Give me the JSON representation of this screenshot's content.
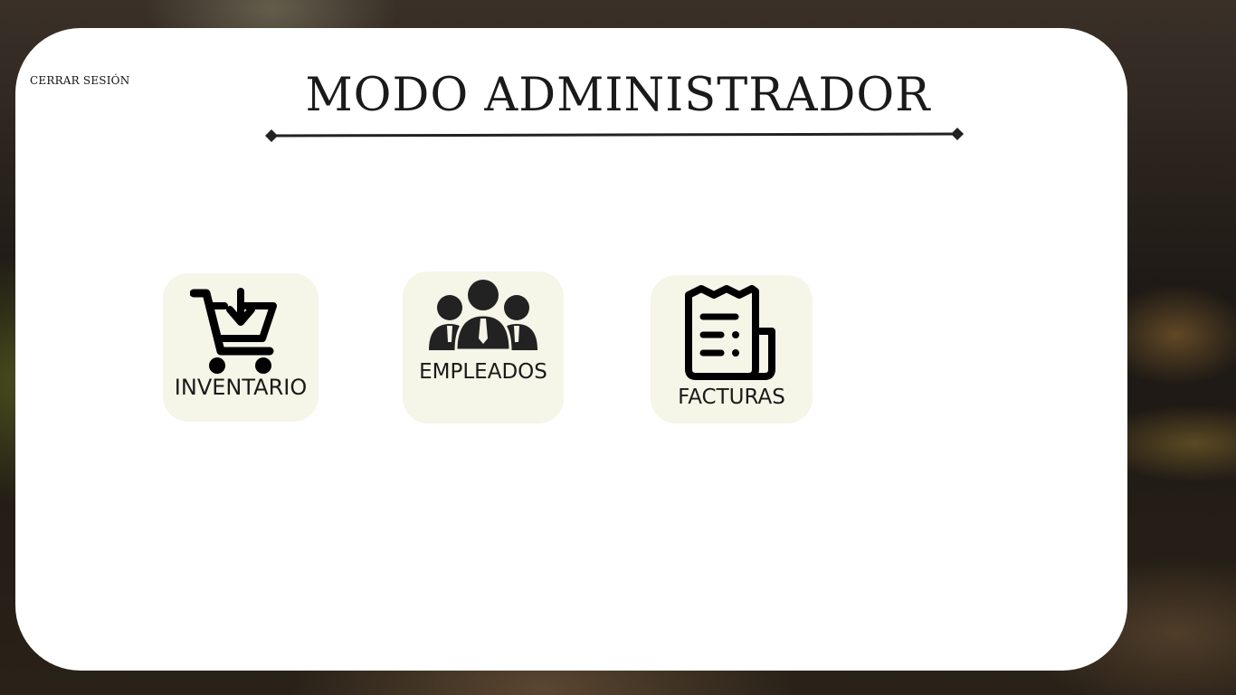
{
  "header": {
    "logout_label": "CERRAR SESIÓN",
    "title": "MODO ADMINISTRADOR"
  },
  "menu": {
    "items": [
      {
        "label": "INVENTARIO",
        "icon": "cart-download-icon"
      },
      {
        "label": "EMPLEADOS",
        "icon": "employees-group-icon"
      },
      {
        "label": "FACTURAS",
        "icon": "receipt-icon"
      }
    ]
  },
  "colors": {
    "card": "#ffffff",
    "tile": "#f5f5e8",
    "text": "#1a1a1a"
  }
}
